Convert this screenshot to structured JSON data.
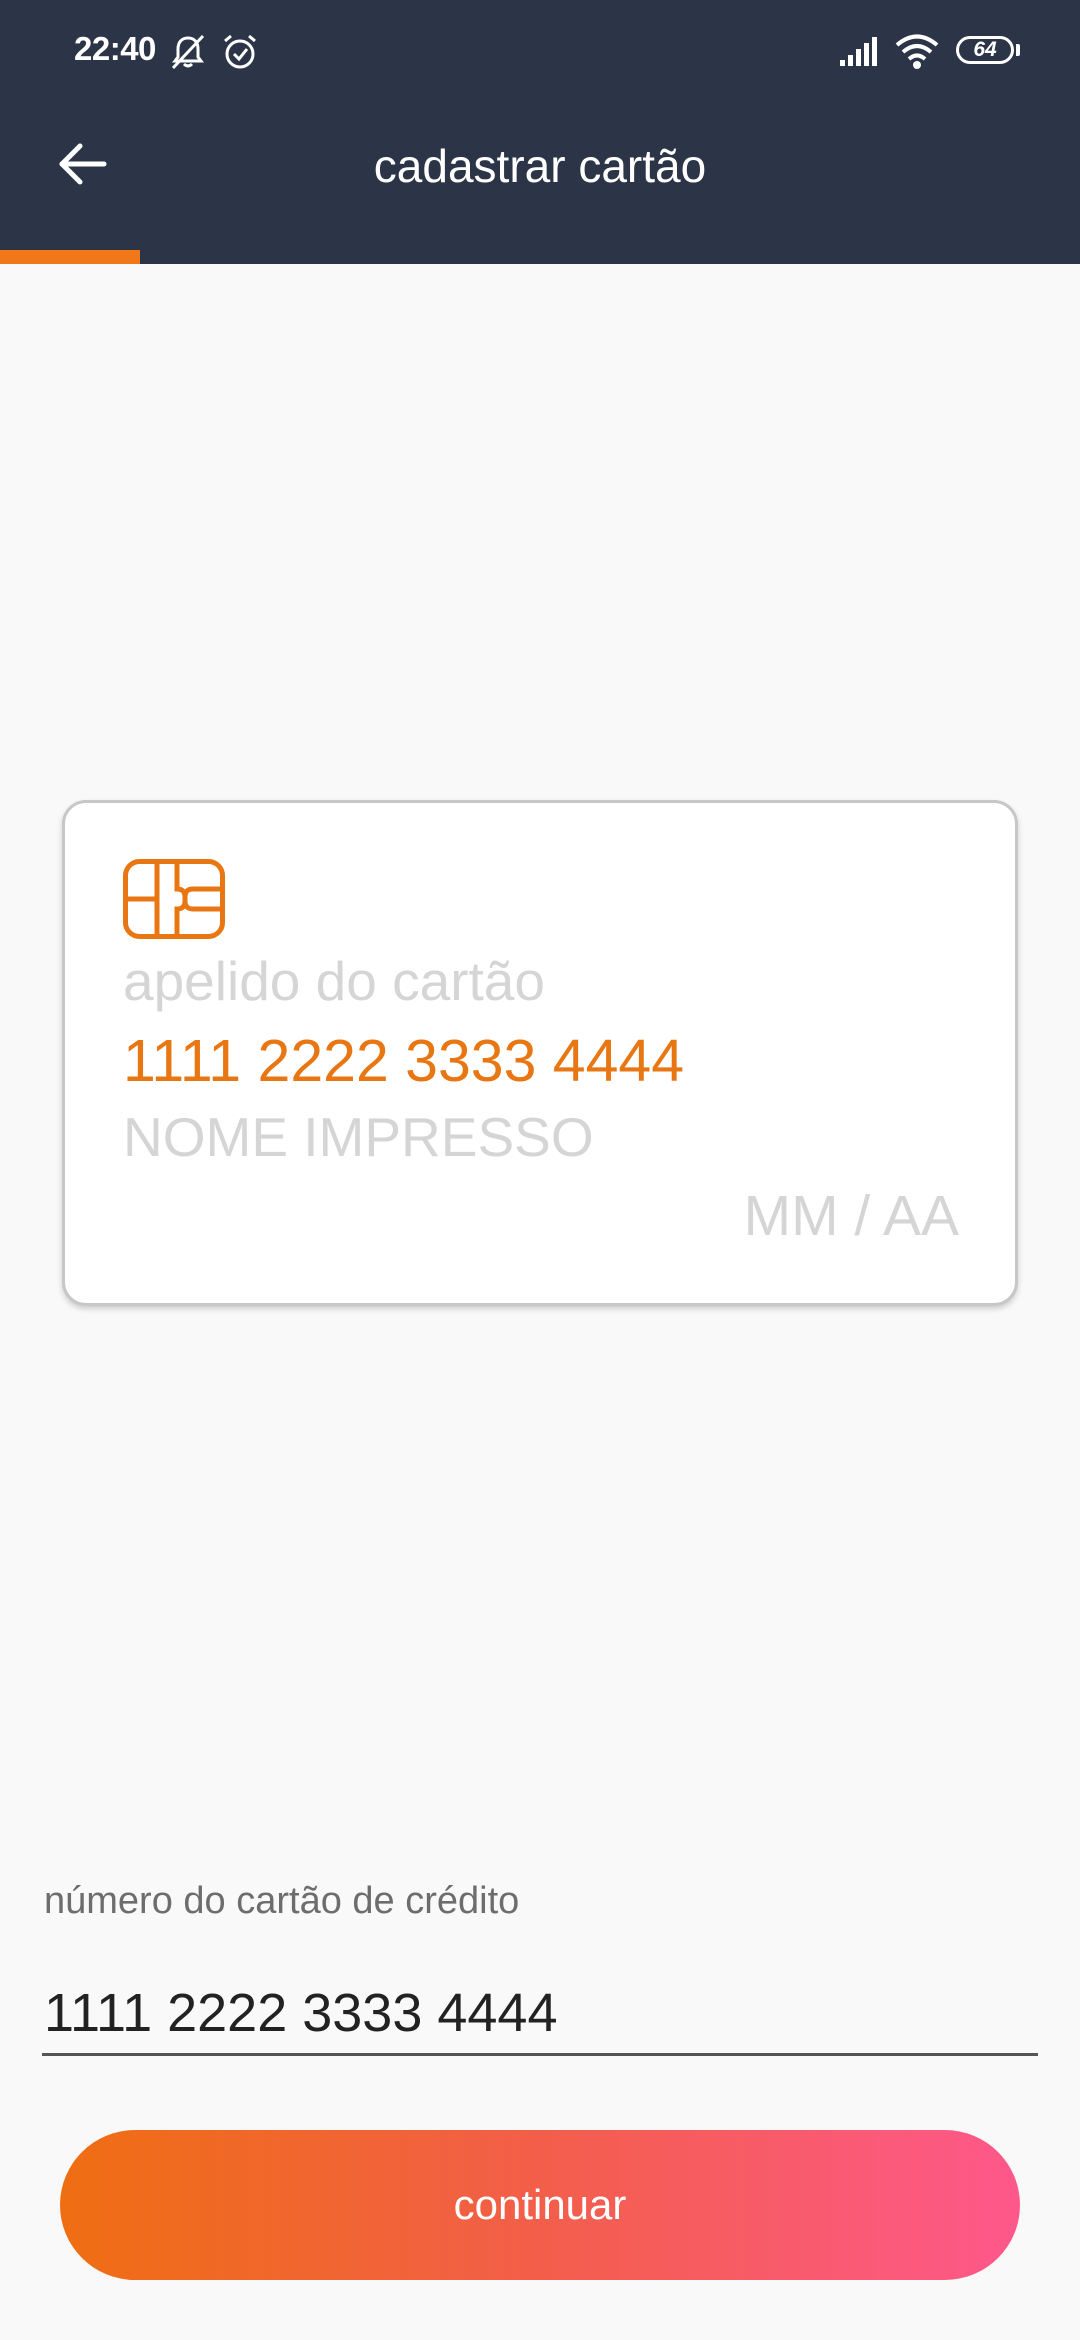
{
  "status_bar": {
    "time": "22:40",
    "battery_level": "64",
    "icons": [
      "mute-icon",
      "alarm-icon",
      "signal-icon",
      "wifi-icon",
      "battery-icon"
    ]
  },
  "header": {
    "title": "cadastrar cartão",
    "back_icon": "arrow-left-icon",
    "progress_percent": 13,
    "background_color": "#2c3547",
    "progress_color": "#f07818"
  },
  "card_preview": {
    "chip_icon": "card-chip-icon",
    "nickname_placeholder": "apelido do cartão",
    "number": "1111 2222 3333 4444",
    "name_placeholder": "NOME IMPRESSO",
    "expiry_placeholder": "MM / AA",
    "accent_color": "#e87612",
    "placeholder_color": "#d5d5d5"
  },
  "form": {
    "card_number_label": "número do cartão de crédito",
    "card_number_value": "1111 2222 3333 4444"
  },
  "actions": {
    "continue_label": "continuar",
    "gradient_start": "#ef6e12",
    "gradient_end": "#fe588b"
  }
}
